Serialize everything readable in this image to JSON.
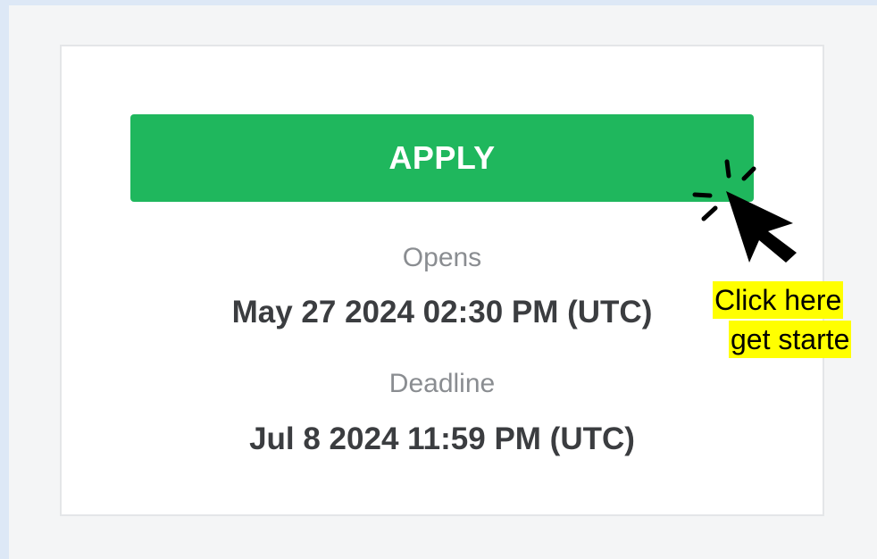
{
  "apply": {
    "label": "APPLY"
  },
  "opens": {
    "label": "Opens",
    "value": "May 27 2024 02:30 PM (UTC)"
  },
  "deadline": {
    "label": "Deadline",
    "value": "Jul 8 2024 11:59 PM (UTC)"
  },
  "callout": {
    "line1": "Click here",
    "line2": "get starte"
  },
  "icons": {
    "pointer": "click-pointer-icon"
  },
  "colors": {
    "accent": "#1fb75d",
    "highlight": "#ffff00",
    "value_text": "#3b3d40",
    "label_text": "#8a8d91"
  }
}
